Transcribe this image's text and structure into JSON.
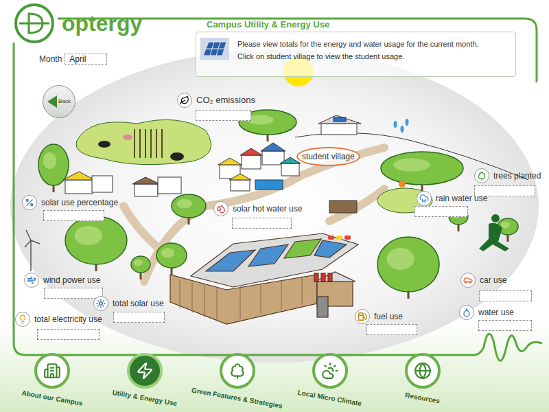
{
  "logo": {
    "text": "optergy"
  },
  "page_title": "Campus Utility & Energy Use",
  "month": {
    "label": "Month",
    "value": "April"
  },
  "info": {
    "lines": [
      "Please view totals for the energy and water usage for the current month.",
      "Click on student village to view the student usage."
    ]
  },
  "back_button": {
    "label": "Back"
  },
  "student_village": {
    "label": "student village"
  },
  "metrics": [
    {
      "label": "CO₂ emissions"
    },
    {
      "label": "solar use percentage"
    },
    {
      "label": "solar hot water use"
    },
    {
      "label": "rain water use"
    },
    {
      "label": "trees planted"
    },
    {
      "label": "wind power use"
    },
    {
      "label": "total solar use"
    },
    {
      "label": "total electricity use"
    },
    {
      "label": "fuel use"
    },
    {
      "label": "car use"
    },
    {
      "label": "water use"
    }
  ],
  "nav": [
    {
      "label": "About our Campus",
      "selected": false
    },
    {
      "label": "Utility & Energy Use",
      "selected": true
    },
    {
      "label": "Green Features & Strategies",
      "selected": false
    },
    {
      "label": "Local Micro Climate",
      "selected": false
    },
    {
      "label": "Resources",
      "selected": false
    }
  ]
}
